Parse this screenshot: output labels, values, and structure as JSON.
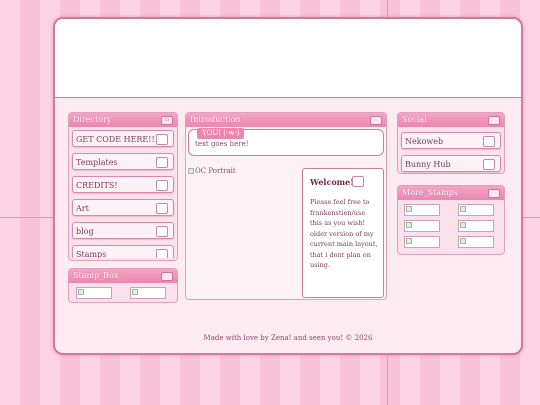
{
  "directory": {
    "title": "Directory",
    "title_btn": "",
    "items": [
      {
        "label": "GET CODE HERE!!!!"
      },
      {
        "label": "Templates"
      },
      {
        "label": "CREDITS!"
      },
      {
        "label": "Art"
      },
      {
        "label": "blog"
      },
      {
        "label": "Stamps"
      }
    ]
  },
  "stamp_box": {
    "title": "Stamp_Box"
  },
  "intro": {
    "title": "Introduction",
    "name_tag": "YOU! (-w-)",
    "text": "text goes here!"
  },
  "portrait": {
    "alt": "OC Portrait"
  },
  "welcome": {
    "title": "Welcome!",
    "text": "Please feel free to frankenstien/use this as you wish! older version of my current main layout, that i dont plan on using."
  },
  "socials": {
    "title": "Social",
    "items": [
      {
        "label": "Nekoweb"
      },
      {
        "label": "Bunny Hub"
      }
    ]
  },
  "more_stamps": {
    "title": "More_Stamps"
  },
  "footer": {
    "text": "Made with love by Zena! and seen you! © 2026"
  },
  "colors": {
    "accent": "#ec86ae",
    "border": "#d27a9c",
    "panel_bg": "#fbe1ec",
    "stripe_light": "#fbd3e3",
    "stripe_dark": "#f8c2d7"
  }
}
